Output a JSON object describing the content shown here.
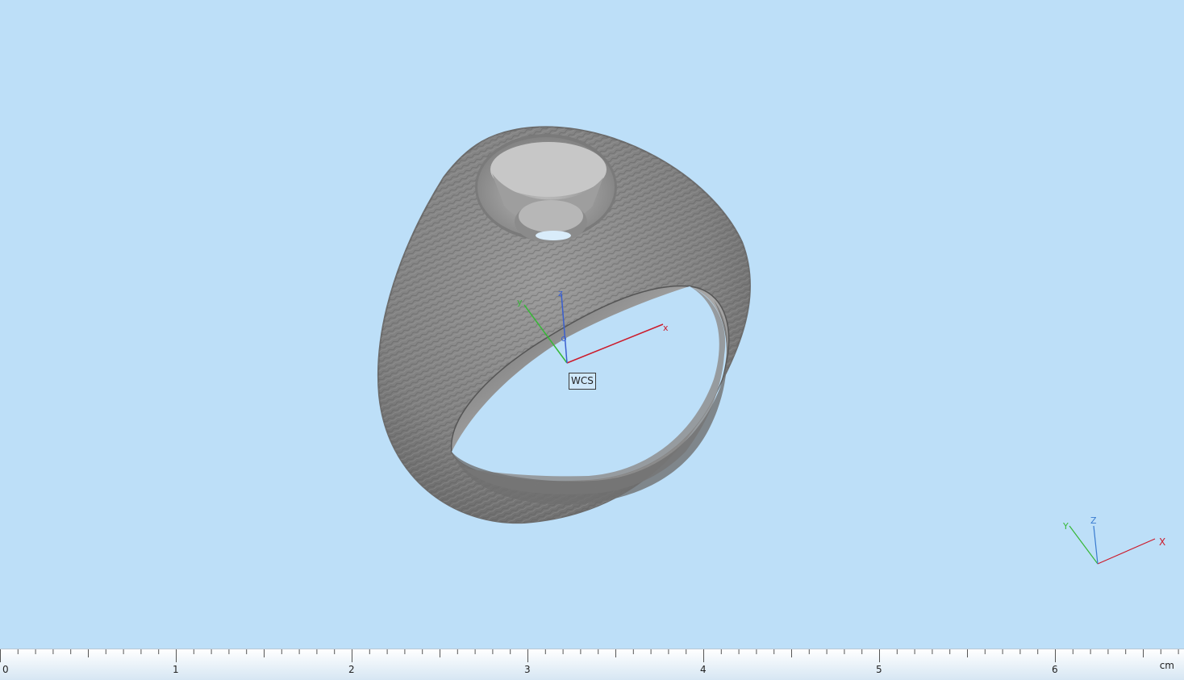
{
  "viewport": {
    "wcs_label": "WCS",
    "center_axes": {
      "x": "x",
      "y": "y",
      "z": "z"
    },
    "corner_axes": {
      "x": "X",
      "y": "Y",
      "z": "Z"
    },
    "colors": {
      "background": "#bddff8",
      "x_axis": "#cc1b2b",
      "y_axis": "#37b837",
      "z_axis": "#3a5fcf",
      "model": "#8a8a8a"
    }
  },
  "ruler": {
    "labels": [
      "0",
      "1",
      "2",
      "3",
      "4",
      "5",
      "6"
    ],
    "unit": "cm"
  }
}
